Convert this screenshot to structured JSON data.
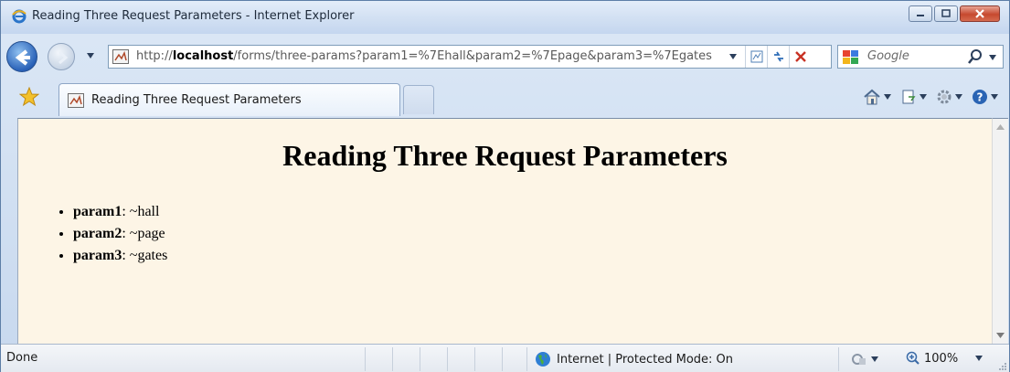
{
  "window": {
    "title": "Reading Three Request Parameters - Internet Explorer"
  },
  "address": {
    "url_prefix": "http://",
    "url_host": "localhost",
    "url_rest": "/forms/three-params?param1=%7Ehall&param2=%7Epage&param3=%7Egates"
  },
  "search": {
    "placeholder": "Google"
  },
  "tabs": [
    {
      "label": "Reading Three Request Parameters"
    }
  ],
  "page": {
    "title": "Reading Three Request Parameters",
    "params": [
      {
        "name": "param1",
        "sep": ": ",
        "value": "~hall"
      },
      {
        "name": "param2",
        "sep": ": ",
        "value": "~page"
      },
      {
        "name": "param3",
        "sep": ": ",
        "value": "~gates"
      }
    ]
  },
  "status": {
    "text": "Done",
    "zone": "Internet | Protected Mode: On",
    "zoom": "100%"
  },
  "colors": {
    "page_background": "#fdf5e6",
    "chrome_background": "#c9d7ea"
  }
}
